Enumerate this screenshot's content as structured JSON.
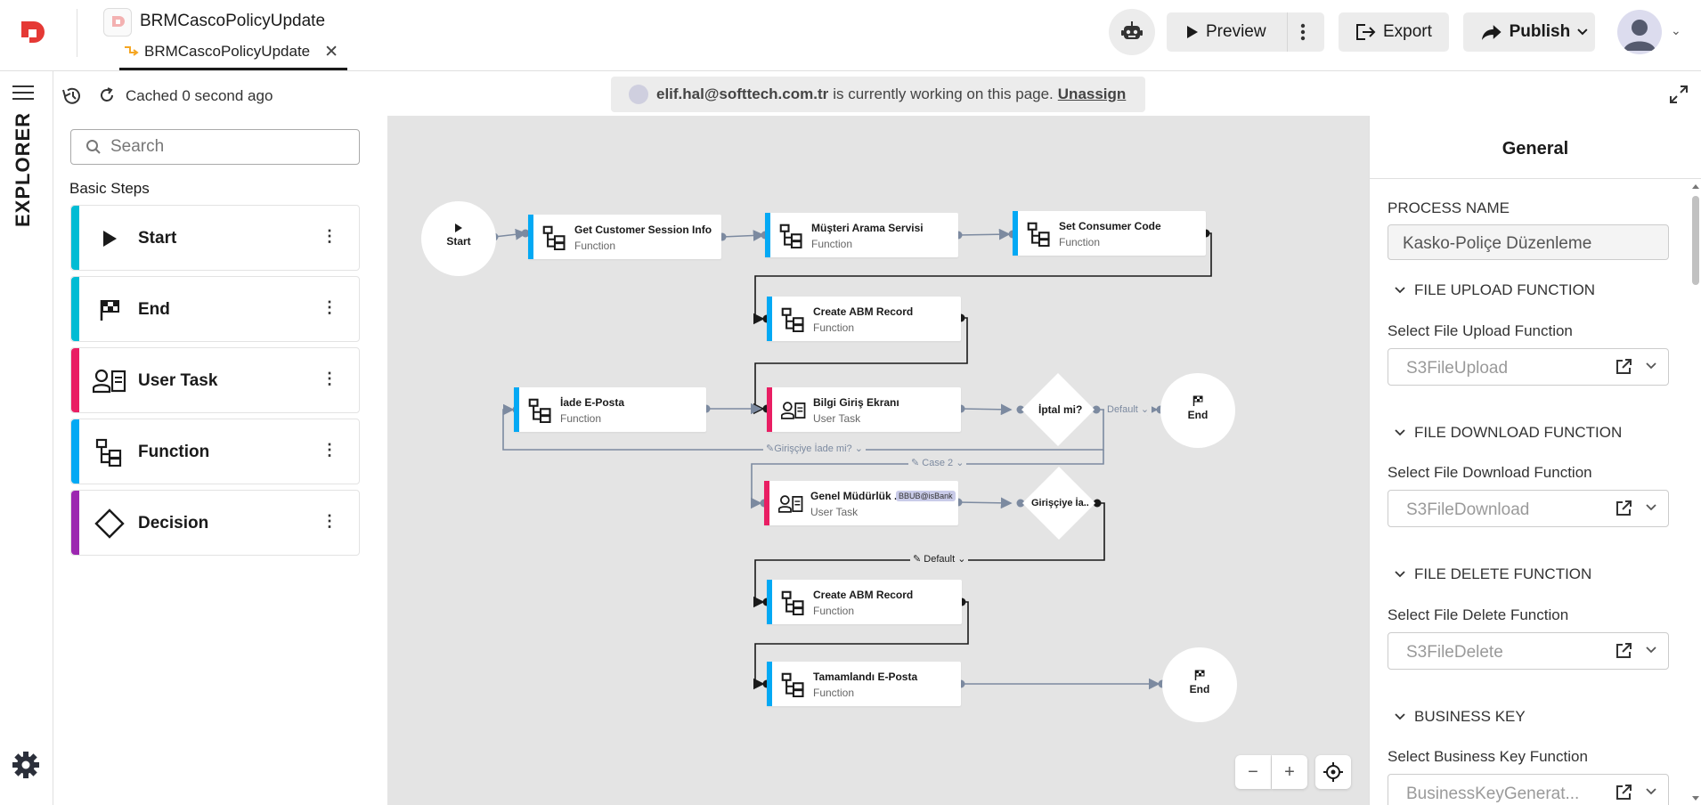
{
  "header": {
    "app_title": "BRMCascoPolicyUpdate",
    "tab_label": "BRMCascoPolicyUpdate",
    "preview_label": "Preview",
    "export_label": "Export",
    "publish_label": "Publish"
  },
  "explorer": {
    "rail_label": "EXPLORER",
    "cached_text": "Cached 0 second ago",
    "search_placeholder": "Search",
    "section_title": "Basic Steps",
    "steps": [
      {
        "label": "Start",
        "color": "#00bcd4",
        "icon": "play-icon"
      },
      {
        "label": "End",
        "color": "#00bcd4",
        "icon": "finish-flag-icon"
      },
      {
        "label": "User Task",
        "color": "#e91e63",
        "icon": "user-task-icon"
      },
      {
        "label": "Function",
        "color": "#03a9f4",
        "icon": "function-icon"
      },
      {
        "label": "Decision",
        "color": "#9c27b0",
        "icon": "diamond-icon"
      }
    ]
  },
  "banner": {
    "user": "elif.hal@softtech.com.tr",
    "text": "is currently working on this page.",
    "action": "Unassign"
  },
  "flow": {
    "start_label": "Start",
    "end_label": "End",
    "nodes": [
      {
        "title": "Get Customer Session Info",
        "subtitle": "Function",
        "type": "function"
      },
      {
        "title": "Müşteri Arama Servisi",
        "subtitle": "Function",
        "type": "function"
      },
      {
        "title": "Set Consumer Code",
        "subtitle": "Function",
        "type": "function"
      },
      {
        "title": "Create ABM Record",
        "subtitle": "Function",
        "type": "function"
      },
      {
        "title": "İade E-Posta",
        "subtitle": "Function",
        "type": "function"
      },
      {
        "title": "Bilgi Giriş Ekranı",
        "subtitle": "User Task",
        "type": "user-task"
      },
      {
        "title": "Genel Müdürlük ..",
        "subtitle": "User Task",
        "type": "user-task",
        "chip": "BBUB@isBank"
      },
      {
        "title": "Create ABM Record",
        "subtitle": "Function",
        "type": "function"
      },
      {
        "title": "Tamamlandı E-Posta",
        "subtitle": "Function",
        "type": "function"
      }
    ],
    "decisions": [
      "İptal mi?",
      "Girişçiye İa.."
    ],
    "edge_labels": {
      "default_1": "Default",
      "girisciye": "Girişçiye İade mi?",
      "case2": "Case 2",
      "default_2": "Default"
    },
    "colors": {
      "function": "#03a9f4",
      "user_task": "#e91e63"
    }
  },
  "zoom": {
    "minus": "−",
    "plus": "+"
  },
  "properties": {
    "title": "General",
    "process_name_label": "PROCESS NAME",
    "process_name_value": "Kasko-Poliçe Düzenleme",
    "sections": [
      {
        "heading": "FILE UPLOAD FUNCTION",
        "label": "Select File Upload Function",
        "value": "S3FileUpload"
      },
      {
        "heading": "FILE DOWNLOAD FUNCTION",
        "label": "Select File Download Function",
        "value": "S3FileDownload"
      },
      {
        "heading": "FILE DELETE FUNCTION",
        "label": "Select File Delete Function",
        "value": "S3FileDelete"
      },
      {
        "heading": "BUSINESS KEY",
        "label": "Select Business Key Function",
        "value": "BusinessKeyGenerat..."
      }
    ]
  }
}
